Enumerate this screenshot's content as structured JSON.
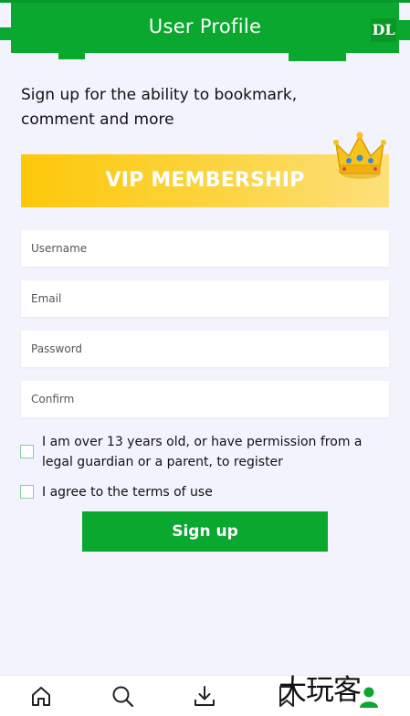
{
  "header": {
    "title": "User Profile",
    "logo_text": "DL",
    "brand_color": "#0aa82f"
  },
  "intro": {
    "text": "Sign up for the ability to bookmark, comment and more"
  },
  "vip_banner": {
    "label": "VIP MEMBERSHIP",
    "icon": "crown-icon"
  },
  "form": {
    "username": {
      "value": "",
      "placeholder": "Username"
    },
    "email": {
      "value": "",
      "placeholder": "Email"
    },
    "password": {
      "value": "",
      "placeholder": "Password"
    },
    "confirm": {
      "value": "",
      "placeholder": "Confirm"
    },
    "age_check": {
      "label": "I am over 13 years old, or have permission from a legal guardian or a parent, to register",
      "checked": false
    },
    "terms_check": {
      "label": "I agree to the terms of use",
      "checked": false
    },
    "submit_label": "Sign up"
  },
  "bottom_nav": {
    "items": [
      {
        "icon": "home-icon"
      },
      {
        "icon": "search-icon"
      },
      {
        "icon": "download-icon"
      },
      {
        "icon": "bookmark-icon"
      },
      {
        "icon": "user-icon",
        "active": true
      }
    ]
  },
  "watermark": {
    "text": "大玩客"
  }
}
